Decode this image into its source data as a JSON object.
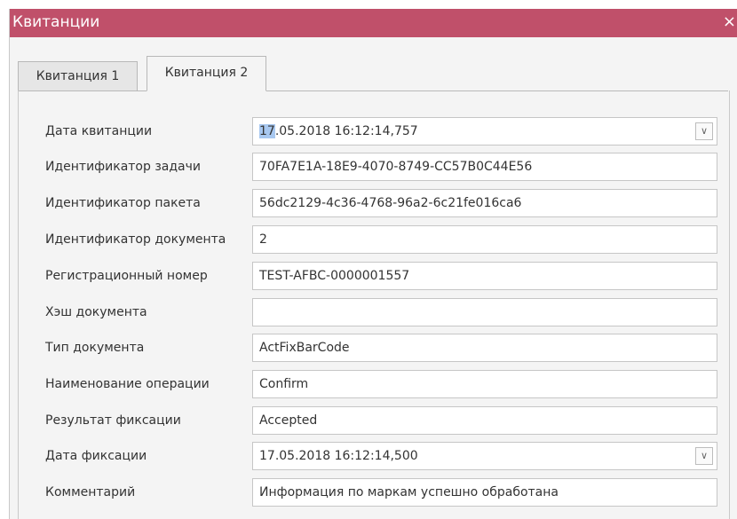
{
  "window": {
    "title": "Квитанции",
    "close_glyph": "×"
  },
  "tabs": [
    {
      "label": "Квитанция 1",
      "active": false
    },
    {
      "label": "Квитанция 2",
      "active": true
    }
  ],
  "form": {
    "receipt_date": {
      "label": "Дата квитанции",
      "value_selected": "17",
      "value_rest": ".05.2018 16:12:14,757"
    },
    "task_id": {
      "label": "Идентификатор задачи",
      "value": "70FA7E1A-18E9-4070-8749-CC57B0C44E56"
    },
    "package_id": {
      "label": "Идентификатор пакета",
      "value": "56dc2129-4c36-4768-96a2-6c21fe016ca6"
    },
    "document_id": {
      "label": "Идентификатор документа",
      "value": "2"
    },
    "reg_number": {
      "label": "Регистрационный номер",
      "value": "TEST-AFBC-0000001557"
    },
    "doc_hash": {
      "label": "Хэш документа",
      "value": ""
    },
    "doc_type": {
      "label": "Тип документа",
      "value": "ActFixBarCode"
    },
    "operation_name": {
      "label": "Наименование операции",
      "value": "Confirm"
    },
    "fix_result": {
      "label": "Результат фиксации",
      "value": "Accepted"
    },
    "fix_date": {
      "label": "Дата фиксации",
      "value": "17.05.2018 16:12:14,500"
    },
    "comment": {
      "label": "Комментарий",
      "value": "Информация по маркам успешно обработана"
    }
  },
  "icons": {
    "dropdown": "chevron-down-icon",
    "close": "close-icon"
  },
  "colors": {
    "titlebar": "#c0506a",
    "selection": "#a8c8f0"
  }
}
